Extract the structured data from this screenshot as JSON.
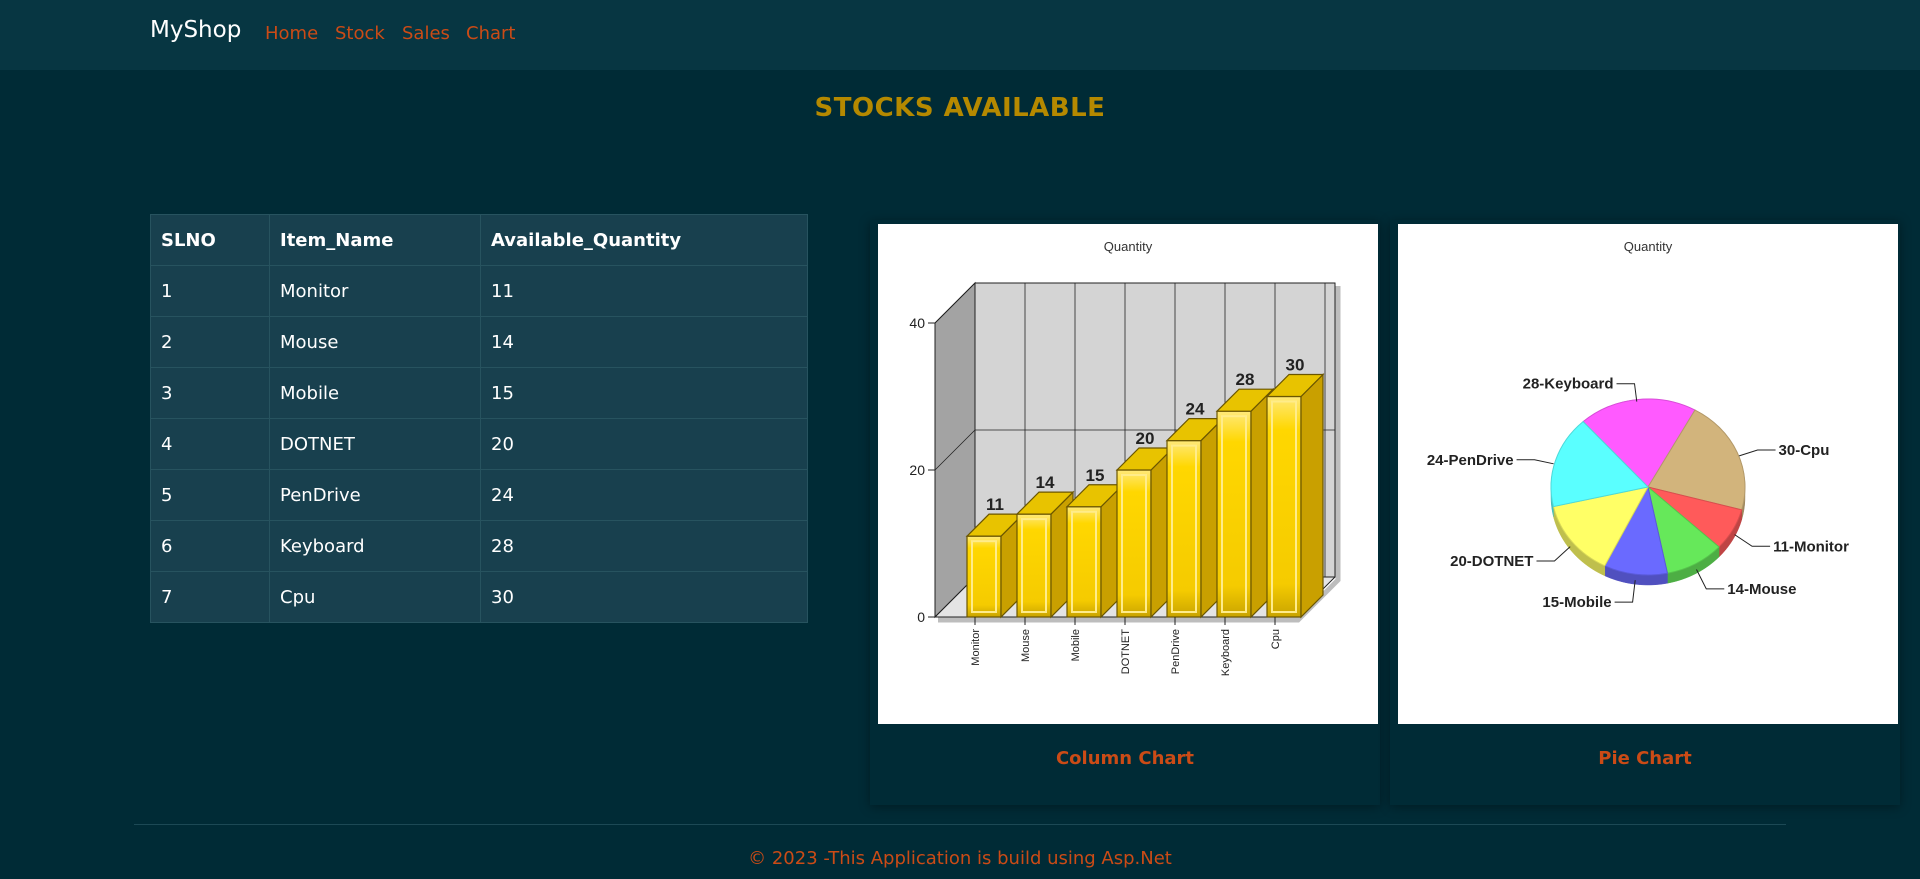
{
  "nav": {
    "brand": "MyShop",
    "links": [
      "Home",
      "Stock",
      "Sales",
      "Chart"
    ]
  },
  "page_title": "STOCKS AVAILABLE",
  "table": {
    "headers": [
      "SLNO",
      "Item_Name",
      "Available_Quantity"
    ],
    "rows": [
      [
        "1",
        "Monitor",
        "11"
      ],
      [
        "2",
        "Mouse",
        "14"
      ],
      [
        "3",
        "Mobile",
        "15"
      ],
      [
        "4",
        "DOTNET",
        "20"
      ],
      [
        "5",
        "PenDrive",
        "24"
      ],
      [
        "6",
        "Keyboard",
        "28"
      ],
      [
        "7",
        "Cpu",
        "30"
      ]
    ]
  },
  "charts": {
    "column_caption": "Column Chart",
    "pie_caption": "Pie Chart"
  },
  "chart_data": [
    {
      "type": "bar",
      "title": "Quantity",
      "categories": [
        "Monitor",
        "Mouse",
        "Mobile",
        "DOTNET",
        "PenDrive",
        "Keyboard",
        "Cpu"
      ],
      "values": [
        11,
        14,
        15,
        20,
        24,
        28,
        30
      ],
      "yticks": [
        0,
        20,
        40
      ],
      "ylim": [
        0,
        40
      ],
      "bar_color": "#ffd700",
      "grid": true
    },
    {
      "type": "pie",
      "title": "Quantity",
      "labels": [
        "11-Monitor",
        "14-Mouse",
        "15-Mobile",
        "20-DOTNET",
        "24-PenDrive",
        "28-Keyboard",
        "30-Cpu"
      ],
      "values": [
        11,
        14,
        15,
        20,
        24,
        28,
        30
      ],
      "colors": [
        "#ff5a5a",
        "#66e85a",
        "#6a6aff",
        "#ffff66",
        "#5affff",
        "#ff5aff",
        "#d2b47c"
      ]
    }
  ],
  "footer": "© 2023 -This Application is build using Asp.Net",
  "colors": {
    "background": "#002b36",
    "navbar": "#073642",
    "accent_orange": "#cb4b16",
    "title_gold": "#b58900",
    "table_bg": "#18404e"
  }
}
